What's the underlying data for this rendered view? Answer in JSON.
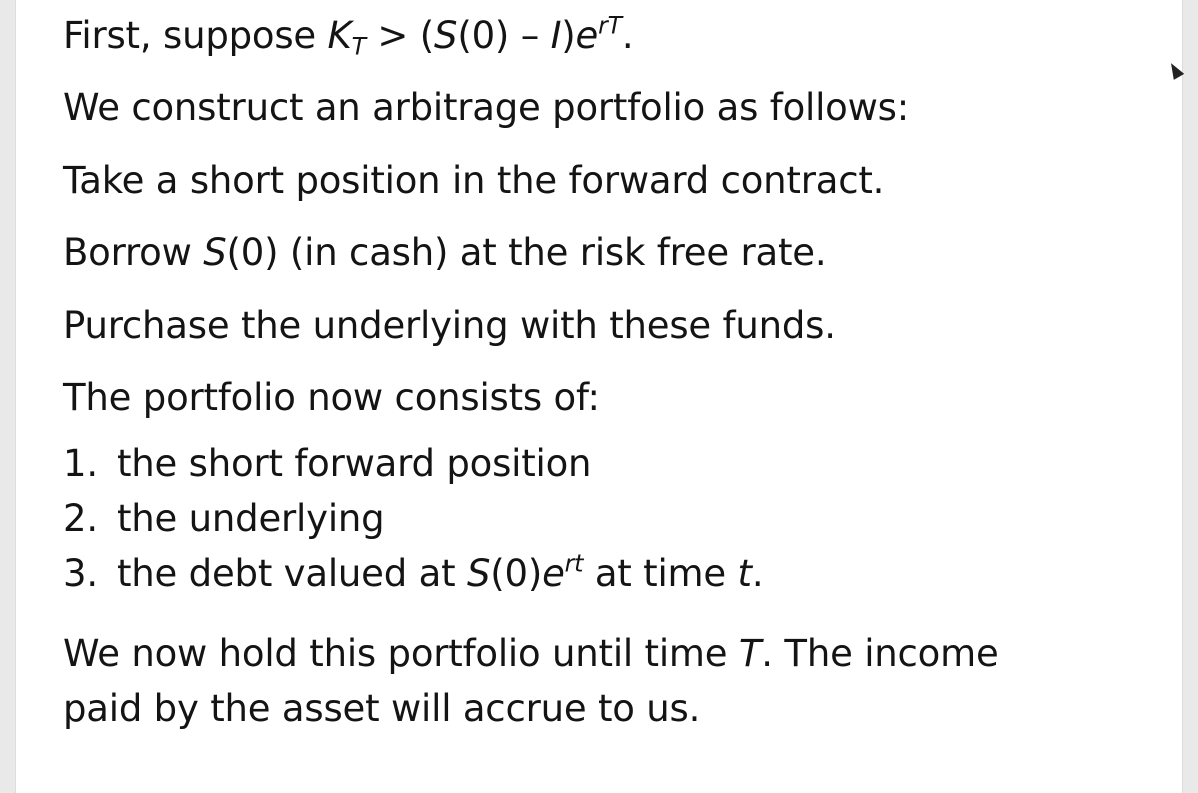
{
  "slide": {
    "line1": {
      "pre": "First, suppose ",
      "k": "K",
      "k_sub": "T",
      "mid": " > (",
      "s": "S",
      "mid2": "(0) – ",
      "i": "I",
      "mid3": ")",
      "e": "e",
      "e_sup": "rT",
      "post": "."
    },
    "line2": "We construct an arbitrage portfolio as follows:",
    "line3": "Take a short position in the forward contract.",
    "line4": {
      "pre": "Borrow ",
      "s": "S",
      "post": "(0) (in cash) at the risk free rate."
    },
    "line5": "Purchase the underlying with these funds.",
    "line6": "The portfolio now consists of:",
    "list": [
      {
        "num": "1.",
        "text": "the short forward position"
      },
      {
        "num": "2.",
        "text": "the underlying"
      },
      {
        "num": "3.",
        "pre": "the debt valued at ",
        "s": "S",
        "mid": "(0)",
        "e": "e",
        "e_sup": "rt",
        "mid2": " at time ",
        "t": "t",
        "post": "."
      }
    ],
    "closing": {
      "pre": "We now hold this portfolio until time ",
      "t": "T",
      "post": ". The income paid by the asset will accrue to us."
    }
  }
}
